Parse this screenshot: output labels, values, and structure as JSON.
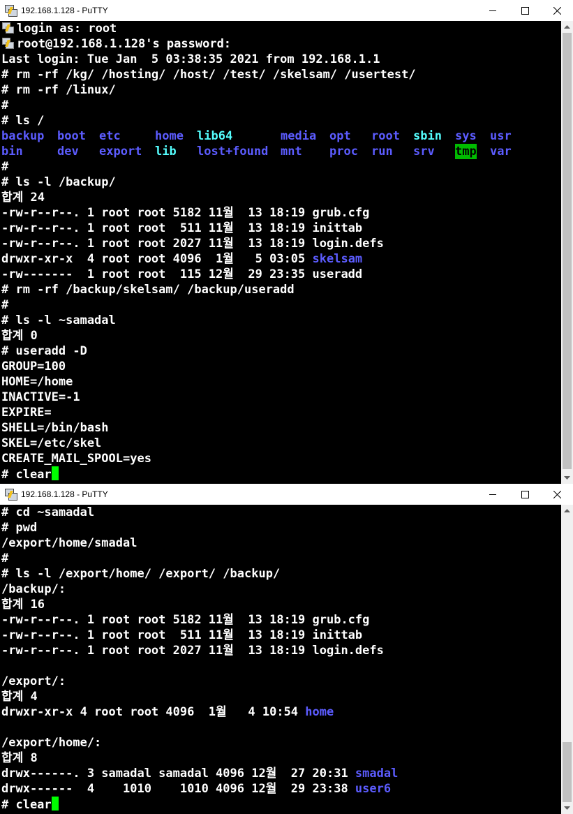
{
  "window1": {
    "title": "192.168.1.128 - PuTTY",
    "lines": [
      {
        "icon": true,
        "text": "login as: root"
      },
      {
        "icon": true,
        "text": "root@192.168.1.128's password:"
      },
      {
        "text": "Last login: Tue Jan  5 03:38:35 2021 from 192.168.1.1"
      },
      {
        "text": "# rm -rf /kg/ /hosting/ /host/ /test/ /skelsam/ /usertest/"
      },
      {
        "text": "# rm -rf /linux/"
      },
      {
        "text": "#"
      },
      {
        "text": "# ls /"
      }
    ],
    "ls_root_row1": [
      "backup",
      "boot",
      "etc",
      "home",
      "lib64",
      "media",
      "opt",
      "root",
      "sbin",
      "sys",
      "usr"
    ],
    "ls_root_row2": [
      "bin",
      "dev",
      "export",
      "lib",
      "lost+found",
      "mnt",
      "proc",
      "run",
      "srv",
      "tmp",
      "var"
    ],
    "lines2": [
      {
        "text": "#"
      },
      {
        "text": "# ls -l /backup/"
      },
      {
        "text": "합계 24"
      },
      {
        "text": "-rw-r--r--. 1 root root 5182 11월  13 18:19 grub.cfg"
      },
      {
        "text": "-rw-r--r--. 1 root root  511 11월  13 18:19 inittab"
      },
      {
        "text": "-rw-r--r--. 1 root root 2027 11월  13 18:19 login.defs"
      },
      {
        "text": "drwxr-xr-x  4 root root 4096  1월   5 03:05 ",
        "colored": "skelsam"
      },
      {
        "text": "-rw-------  1 root root  115 12월  29 23:35 useradd"
      },
      {
        "text": "# rm -rf /backup/skelsam/ /backup/useradd"
      },
      {
        "text": "#"
      },
      {
        "text": "# ls -l ~samadal"
      },
      {
        "text": "합계 0"
      },
      {
        "text": "# useradd -D"
      },
      {
        "text": "GROUP=100"
      },
      {
        "text": "HOME=/home"
      },
      {
        "text": "INACTIVE=-1"
      },
      {
        "text": "EXPIRE="
      },
      {
        "text": "SHELL=/bin/bash"
      },
      {
        "text": "SKEL=/etc/skel"
      },
      {
        "text": "CREATE_MAIL_SPOOL=yes"
      },
      {
        "text": "# clear",
        "cursor": true
      }
    ]
  },
  "window2": {
    "title": "192.168.1.128 - PuTTY",
    "lines": [
      {
        "text": "# cd ~samadal"
      },
      {
        "text": "# pwd"
      },
      {
        "text": "/export/home/smadal"
      },
      {
        "text": "#"
      },
      {
        "text": "# ls -l /export/home/ /export/ /backup/"
      },
      {
        "text": "/backup/:"
      },
      {
        "text": "합계 16"
      },
      {
        "text": "-rw-r--r--. 1 root root 5182 11월  13 18:19 grub.cfg"
      },
      {
        "text": "-rw-r--r--. 1 root root  511 11월  13 18:19 inittab"
      },
      {
        "text": "-rw-r--r--. 1 root root 2027 11월  13 18:19 login.defs"
      },
      {
        "text": ""
      },
      {
        "text": "/export/:"
      },
      {
        "text": "합계 4"
      },
      {
        "text": "drwxr-xr-x 4 root root 4096  1월   4 10:54 ",
        "colored": "home"
      },
      {
        "text": ""
      },
      {
        "text": "/export/home/:"
      },
      {
        "text": "합계 8"
      },
      {
        "text": "drwx------. 3 samadal samadal 4096 12월  27 20:31 ",
        "colored": "smadal"
      },
      {
        "text": "drwx------  4    1010    1010 4096 12월  29 23:38 ",
        "colored": "user6"
      },
      {
        "text": "# clear",
        "cursor": true
      }
    ]
  },
  "colors": {
    "background": "#000000",
    "foreground": "#ffffff",
    "directory": "#5c5cff",
    "symlink": "#55ffff",
    "sticky_bg": "#00bb00",
    "cursor": "#00ff00"
  }
}
